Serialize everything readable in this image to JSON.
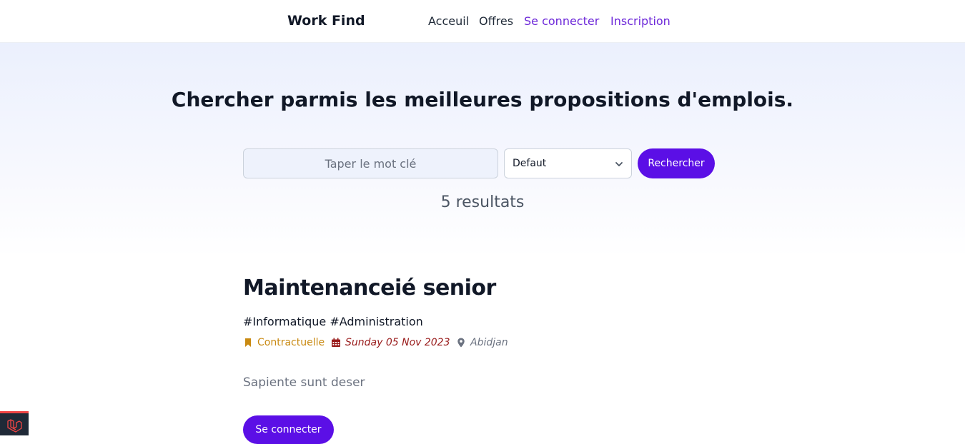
{
  "nav": {
    "brand": "Work Find",
    "links": [
      "Acceuil",
      "Offres",
      "Se connecter",
      "Inscription"
    ]
  },
  "hero": {
    "title": "Chercher parmis les meilleures propositions d'emplois.",
    "search_placeholder": "Taper le mot clé",
    "select_value": "Defaut",
    "search_button": "Rechercher",
    "results": "5 resultats"
  },
  "job": {
    "title": "Maintenanceié senior",
    "tags": "#Informatique #Administration",
    "contract": "Contractuelle",
    "date": "Sunday 05 Nov 2023",
    "location": "Abidjan",
    "description": "Sapiente sunt deser",
    "cta": "Se connecter"
  },
  "colors": {
    "accent": "#5b0fe6",
    "link_purple": "#6d28d9",
    "contract": "#c98a12",
    "date": "#991b1b"
  },
  "icons": [
    "bookmark-icon",
    "calendar-icon",
    "map-pin-icon",
    "chevron-down-icon",
    "laravel-logo-icon"
  ]
}
